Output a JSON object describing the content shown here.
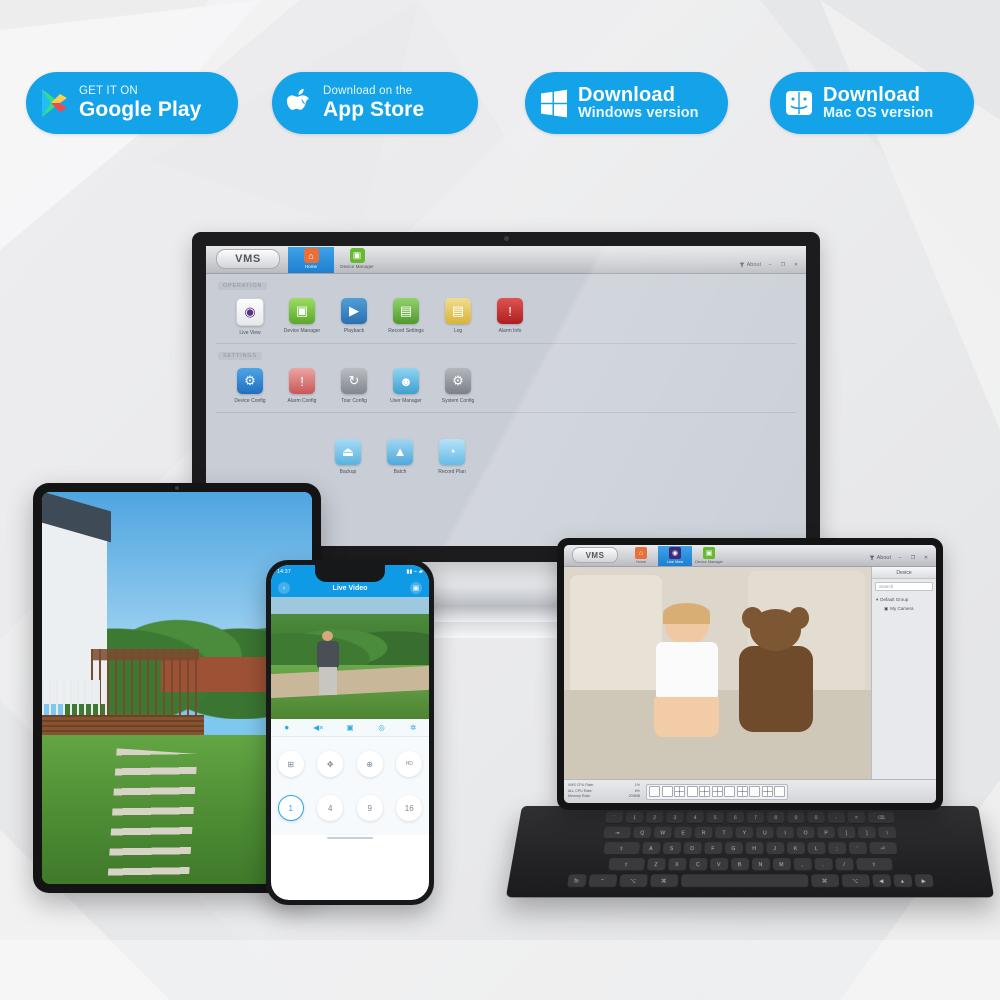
{
  "badges": [
    {
      "id": "google-play",
      "top": "GET IT ON",
      "bottom": "Google Play",
      "icon": "google-play-icon"
    },
    {
      "id": "app-store",
      "top": "Download on the",
      "bottom": "App Store",
      "icon": "apple-icon"
    },
    {
      "id": "windows",
      "top": "Download",
      "bottom": "Windows version",
      "icon": "windows-icon"
    },
    {
      "id": "macos",
      "top": "Download",
      "bottom": "Mac OS version",
      "icon": "mac-finder-icon"
    }
  ],
  "colors": {
    "badge_blue": "#14a3e8",
    "tab_blue": "#2a8fdc",
    "background": "#ebebeb"
  },
  "desktop_vms": {
    "logo": "VMS",
    "tabs": [
      {
        "label": "Home",
        "icon": "home-icon",
        "selected": true,
        "color": "#e8703a"
      },
      {
        "label": "Device Manager",
        "icon": "device-manager-icon",
        "selected": false,
        "color": "#67b92f"
      }
    ],
    "window_controls": {
      "about": "About",
      "minimize": "–",
      "maximize": "❐",
      "close": "✕"
    },
    "sections": [
      {
        "title": "OPERATION",
        "items": [
          {
            "label": "Live View",
            "icon": "live-view-icon",
            "color": "#5d2f87",
            "glyph": "◉"
          },
          {
            "label": "Device Manager",
            "icon": "device-manager-icon",
            "color": "#6cb92f",
            "glyph": "▣"
          },
          {
            "label": "Playback",
            "icon": "playback-icon",
            "color": "#2f7fc4",
            "glyph": "▶"
          },
          {
            "label": "Record Settings",
            "icon": "record-settings-icon",
            "color": "#63b33a",
            "glyph": "▤"
          },
          {
            "label": "Log",
            "icon": "log-icon",
            "color": "#d9b43a",
            "glyph": "▤"
          },
          {
            "label": "Alarm Info",
            "icon": "alarm-info-icon",
            "color": "#cc2f2f",
            "glyph": "!"
          }
        ]
      },
      {
        "title": "SETTINGS",
        "items": [
          {
            "label": "Device Config",
            "icon": "device-config-icon",
            "color": "#2f86d6",
            "glyph": "⚙"
          },
          {
            "label": "Alarm Config",
            "icon": "alarm-config-icon",
            "color": "#d05353",
            "glyph": "!"
          },
          {
            "label": "Tour Config",
            "icon": "tour-config-icon",
            "color": "#8e9299",
            "glyph": "↻"
          },
          {
            "label": "User Manager",
            "icon": "user-manager-icon",
            "color": "#5bb8e8",
            "glyph": "☻"
          },
          {
            "label": "System Config",
            "icon": "system-config-icon",
            "color": "#8a8e95",
            "glyph": "⚙"
          }
        ]
      },
      {
        "title": "",
        "items": [
          {
            "label": "Backup",
            "icon": "backup-icon",
            "color": "#63b7e8",
            "glyph": "⏏"
          },
          {
            "label": "Batch",
            "icon": "batch-icon",
            "color": "#57a9e0",
            "glyph": "▲"
          },
          {
            "label": "Record Plan",
            "icon": "record-plan-icon",
            "color": "#6fc0ea",
            "glyph": "◔"
          }
        ]
      }
    ]
  },
  "phone_app": {
    "status": {
      "time": "14:37",
      "indicators": "▮▮ ⌁ ▰"
    },
    "nav": {
      "title": "Live Video",
      "back_icon": "back-arrow-icon",
      "camera_icon": "camera-switch-icon"
    },
    "toolbar": [
      {
        "label": "mic",
        "icon": "microphone-icon",
        "glyph": "🎙"
      },
      {
        "label": "speaker",
        "icon": "speaker-mute-icon",
        "glyph": "◀"
      },
      {
        "label": "record",
        "icon": "record-video-icon",
        "glyph": "▣"
      },
      {
        "label": "snapshot",
        "icon": "snapshot-camera-icon",
        "glyph": "◎"
      },
      {
        "label": "settings",
        "icon": "settings-gear-icon",
        "glyph": "✲"
      }
    ],
    "controls": [
      {
        "label": "split",
        "icon": "split-screen-icon",
        "glyph": "⊞"
      },
      {
        "label": "ptz",
        "icon": "ptz-pad-icon",
        "glyph": "✥"
      },
      {
        "label": "zoom",
        "icon": "zoom-icon",
        "glyph": "⊕"
      },
      {
        "label": "stream",
        "icon": "stream-quality-icon",
        "glyph": "HD"
      }
    ],
    "layouts": [
      {
        "label": "1",
        "selected": true
      },
      {
        "label": "4",
        "selected": false
      },
      {
        "label": "9",
        "selected": false
      },
      {
        "label": "16",
        "selected": false
      }
    ]
  },
  "tablet_vms": {
    "logo": "VMS",
    "tabs": [
      {
        "label": "Home",
        "icon": "home-icon",
        "selected": false,
        "color": "#e8703a"
      },
      {
        "label": "Live View",
        "icon": "live-view-icon",
        "selected": true,
        "color": "#3c2b7a"
      },
      {
        "label": "Device Manager",
        "icon": "device-manager-icon",
        "selected": false,
        "color": "#67b92f"
      }
    ],
    "window_controls": {
      "about": "About",
      "minimize": "–",
      "maximize": "❐",
      "close": "✕"
    },
    "device_panel": {
      "title": "Device",
      "search_placeholder": "Search",
      "tree": [
        {
          "label": "Default Group",
          "level": 1,
          "icon": "folder-icon"
        },
        {
          "label": "My Camera",
          "level": 2,
          "icon": "camera-icon"
        }
      ]
    },
    "status_bar": {
      "stats": [
        {
          "label": "VMS CPU Rate:",
          "value": "1%"
        },
        {
          "label": "ALL CPU Rate:",
          "value": "6%"
        },
        {
          "label": "Memory Rate:",
          "value": "209MB"
        }
      ],
      "layout_buttons": [
        "1",
        "2",
        "4",
        "6",
        "8",
        "9",
        "13",
        "16",
        "25",
        "36",
        "full"
      ]
    }
  },
  "keyboard": {
    "rows": [
      [
        "`",
        "1",
        "2",
        "3",
        "4",
        "5",
        "6",
        "7",
        "8",
        "9",
        "0",
        "-",
        "=",
        "delete"
      ],
      [
        "tab",
        "Q",
        "W",
        "E",
        "R",
        "T",
        "Y",
        "U",
        "I",
        "O",
        "P",
        "[",
        "]",
        "\\"
      ],
      [
        "caps",
        "A",
        "S",
        "D",
        "F",
        "G",
        "H",
        "J",
        "K",
        "L",
        ";",
        "'",
        "return"
      ],
      [
        "shift",
        "Z",
        "X",
        "C",
        "V",
        "B",
        "N",
        "M",
        ",",
        ".",
        "/",
        "shift"
      ],
      [
        "fn",
        "control",
        "option",
        "cmd",
        "space",
        "cmd",
        "option",
        "◀",
        "▲▼",
        "▶"
      ]
    ]
  }
}
